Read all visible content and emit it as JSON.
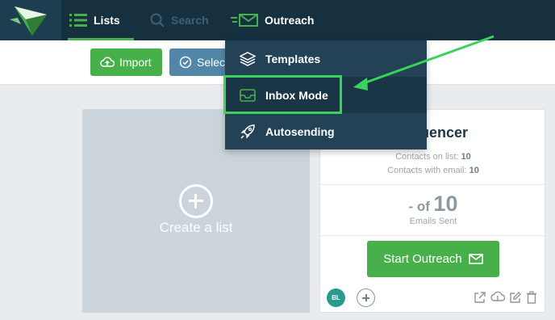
{
  "nav": {
    "logo_icon": "envelope-logo-icon",
    "lists_label": "Lists",
    "search_label": "Search",
    "outreach_label": "Outreach"
  },
  "toolbar": {
    "import_label": "Import",
    "select_label": "Select"
  },
  "dropdown": {
    "items": [
      {
        "label": "Templates",
        "icon": "layers-icon"
      },
      {
        "label": "Inbox Mode",
        "icon": "inbox-icon"
      },
      {
        "label": "Autosending",
        "icon": "rocket-icon"
      }
    ]
  },
  "create_tile": {
    "label": "Create a list"
  },
  "list_card": {
    "title": "Influencer",
    "contacts_on_list_label": "Contacts on list:",
    "contacts_on_list_value": "10",
    "contacts_with_email_label": "Contacts with email:",
    "contacts_with_email_value": "10",
    "sent_prefix": "- of",
    "sent_total": "10",
    "sent_label": "Emails Sent",
    "start_button_label": "Start Outreach",
    "avatar_initials": "BL"
  },
  "colors": {
    "nav_bg": "#16303f",
    "accent_green": "#48b04b",
    "select_blue": "#5286a8",
    "dropdown_bg": "#234256",
    "highlight": "#3ad35a"
  }
}
